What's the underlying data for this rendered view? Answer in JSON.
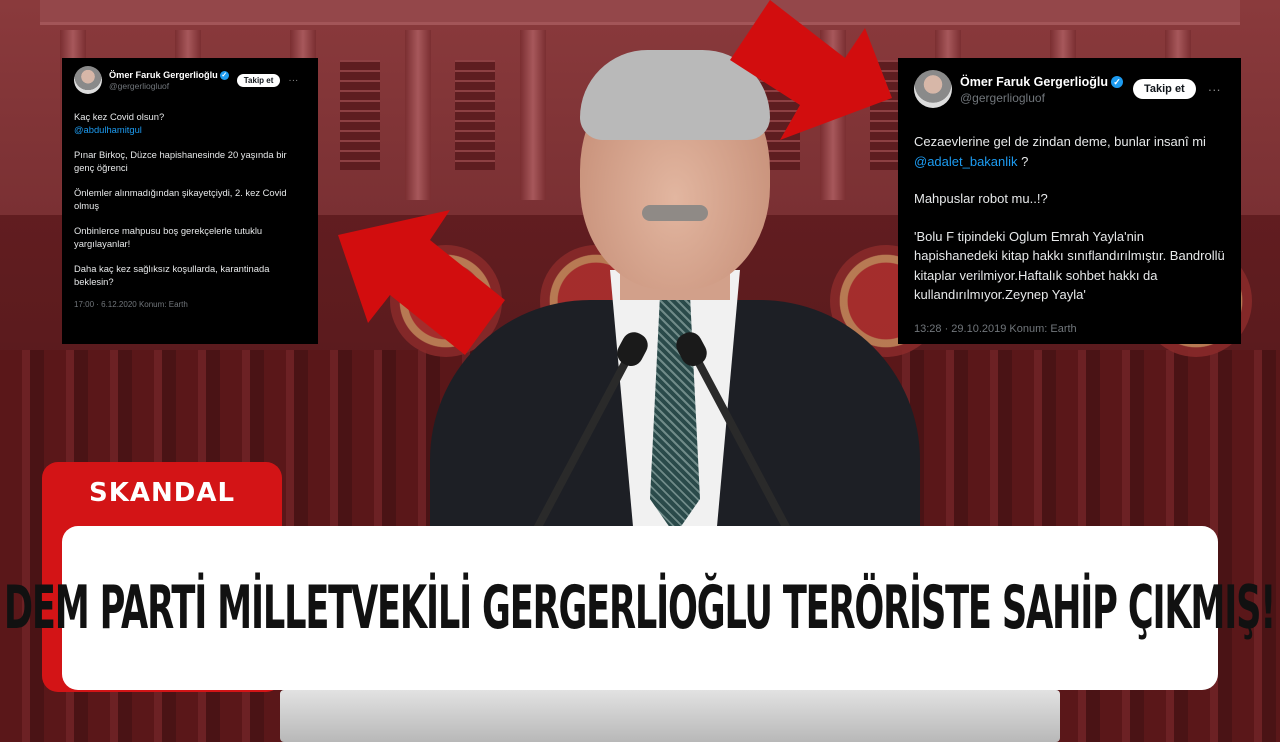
{
  "background": {
    "scene": "press-conference",
    "colors": {
      "curtain": "#5c1b1e",
      "accent_red": "#d31416"
    }
  },
  "tweet_left": {
    "author_name": "Ömer Faruk Gergerlioğlu",
    "verified_icon": "verified-badge-icon",
    "handle": "@gergerliogluof",
    "follow_label": "Takip et",
    "more_icon": "···",
    "line1": "Kaç kez Covid olsun?",
    "mention1": "@abdulhamitgul",
    "para2": "Pınar Birkoç, Düzce hapishanesinde 20 yaşında bir genç öğrenci",
    "para3": "Önlemler alınmadığından şikayetçiydi, 2. kez Covid olmuş",
    "para4": "Onbinlerce mahpusu boş gerekçelerle tutuklu yargılayanlar!",
    "para5": "Daha kaç kez sağlıksız koşullarda, karantinada beklesin?",
    "meta": "17:00 · 6.12.2020 Konum: Earth"
  },
  "tweet_right": {
    "author_name": "Ömer Faruk Gergerlioğlu",
    "verified_icon": "verified-badge-icon",
    "handle": "@gergerliogluof",
    "follow_label": "Takip et",
    "more_icon": "···",
    "para1_text": "Cezaevlerine gel de zindan deme, bunlar insanî mi",
    "para1_mention": "@adalet_bakanlik",
    "para1_end": " ?",
    "para2": "Mahpuslar robot mu..!?",
    "para3": "'Bolu F tipindeki Oglum Emrah Yayla'nin hapishanedeki  kitap hakkı sınıflandırılmıştır. Bandrollü kitaplar verilmiyor.Haftalık sohbet hakkı da kullandırılmıyor.Zeynep Yayla'",
    "meta": "13:28 · 29.10.2019 Konum: Earth"
  },
  "tag_label": "SKANDAL",
  "headline": "DEM PARTİ MİLLETVEKİLİ GERGERLİOĞLU TERÖRİSTE SAHİP ÇIKMIŞ!"
}
